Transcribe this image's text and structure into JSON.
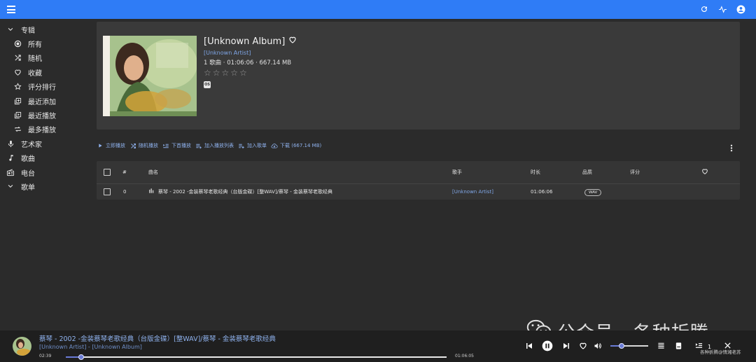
{
  "sidebar": {
    "albums_label": "专辑",
    "items": [
      {
        "label": "所有",
        "icon": "radio-icon"
      },
      {
        "label": "随机",
        "icon": "shuffle-icon"
      },
      {
        "label": "收藏",
        "icon": "heart-icon"
      },
      {
        "label": "评分排行",
        "icon": "star-icon"
      },
      {
        "label": "最近添加",
        "icon": "library-add-icon"
      },
      {
        "label": "最近播放",
        "icon": "library-play-icon"
      },
      {
        "label": "最多播放",
        "icon": "repeat-icon"
      }
    ],
    "artists_label": "艺术家",
    "songs_label": "歌曲",
    "radio_label": "电台",
    "playlists_label": "歌单"
  },
  "album": {
    "title": "[Unknown Album]",
    "artist": "[Unknown Artist]",
    "meta": "1 歌曲 · 01:06:06 · 667.14 MB",
    "rating": 0,
    "os_badge": "OS"
  },
  "actions": {
    "play_now": "立即播放",
    "shuffle": "随机播放",
    "play_next": "下首播放",
    "add_to_queue": "加入播放列表",
    "add_to_playlist": "加入歌单",
    "download": "下载 (667.14 MB)"
  },
  "table": {
    "headers": {
      "index": "#",
      "title": "曲名",
      "artist": "歌手",
      "duration": "时长",
      "quality": "品质",
      "rating": "评分"
    },
    "rows": [
      {
        "index": "0",
        "title": "蔡琴 - 2002 -金装蔡琴老歌经典（台版金碟）[整WAV]/蔡琴 - 金装蔡琴老歌经典",
        "artist": "[Unknown Artist]",
        "duration": "01:06:06",
        "quality": "WAV"
      }
    ]
  },
  "player": {
    "song": "蔡琴 - 2002 -金装蔡琴老歌经典（台版金碟）[整WAV]/蔡琴 - 金装蔡琴老歌经典",
    "subtitle": "[Unknown Artist] - [Unknown Album]",
    "current_time": "02:39",
    "duration": "01:06:05",
    "progress": 0.04,
    "queue_count": "1"
  },
  "watermark": {
    "text": "公众号 · 各种折腾",
    "small": "各种折腾@情湘老苏"
  },
  "colors": {
    "appbar": "#2f7cf6",
    "accent": "#6a7bd6",
    "link": "#7fa6e6"
  }
}
